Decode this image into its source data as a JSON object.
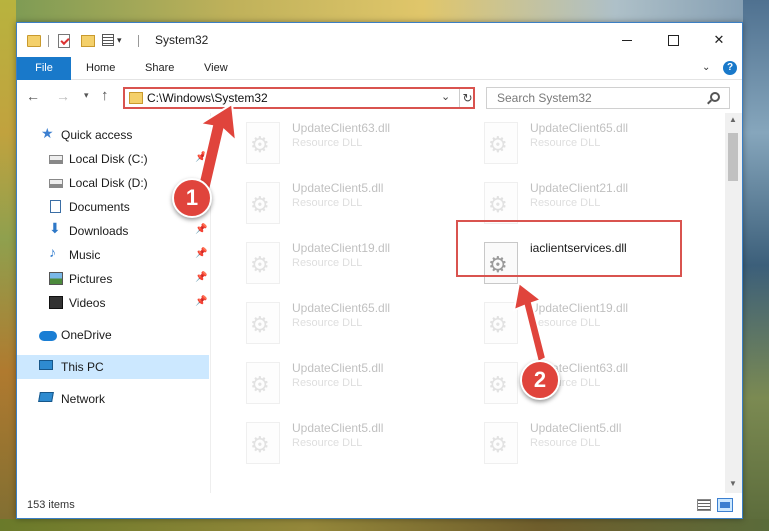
{
  "window": {
    "title": "System32"
  },
  "ribbon": {
    "tabs": [
      "File",
      "Home",
      "Share",
      "View"
    ],
    "help": "?"
  },
  "navigation": {
    "address": "C:\\Windows\\System32",
    "search_placeholder": "Search System32"
  },
  "sidebar": {
    "items": [
      {
        "label": "Quick access",
        "icon": "star-icon"
      },
      {
        "label": "Local Disk (C:)",
        "icon": "drive-icon",
        "pinned": true
      },
      {
        "label": "Local Disk (D:)",
        "icon": "drive-icon"
      },
      {
        "label": "Documents",
        "icon": "documents-icon",
        "pinned": true
      },
      {
        "label": "Downloads",
        "icon": "download-icon",
        "pinned": true
      },
      {
        "label": "Music",
        "icon": "music-icon",
        "pinned": true
      },
      {
        "label": "Pictures",
        "icon": "pictures-icon",
        "pinned": true
      },
      {
        "label": "Videos",
        "icon": "videos-icon",
        "pinned": true
      },
      {
        "label": "OneDrive",
        "icon": "cloud-icon"
      },
      {
        "label": "This PC",
        "icon": "computer-icon",
        "selected": true
      },
      {
        "label": "Network",
        "icon": "network-icon"
      }
    ]
  },
  "files": {
    "left": [
      {
        "name": "UpdateClient63.dll",
        "type": "Resource DLL"
      },
      {
        "name": "UpdateClient5.dll",
        "type": "Resource DLL"
      },
      {
        "name": "UpdateClient19.dll",
        "type": "Resource DLL"
      },
      {
        "name": "UpdateClient65.dll",
        "type": "Resource DLL"
      },
      {
        "name": "UpdateClient5.dll",
        "type": "Resource DLL"
      },
      {
        "name": "UpdateClient5.dll",
        "type": "Resource DLL"
      }
    ],
    "right": [
      {
        "name": "UpdateClient65.dll",
        "type": "Resource DLL"
      },
      {
        "name": "UpdateClient21.dll",
        "type": "Resource DLL"
      },
      {
        "name": "iaclientservices.dll",
        "type": "",
        "highlighted": true
      },
      {
        "name": "UpdateClient19.dll",
        "type": "Resource DLL"
      },
      {
        "name": "UpdateClient63.dll",
        "type": "Resource DLL"
      },
      {
        "name": "UpdateClient5.dll",
        "type": "Resource DLL"
      }
    ]
  },
  "status": {
    "item_count": "153 items"
  },
  "annotations": {
    "callout_1": "1",
    "callout_2": "2",
    "color": "#e0443c"
  }
}
